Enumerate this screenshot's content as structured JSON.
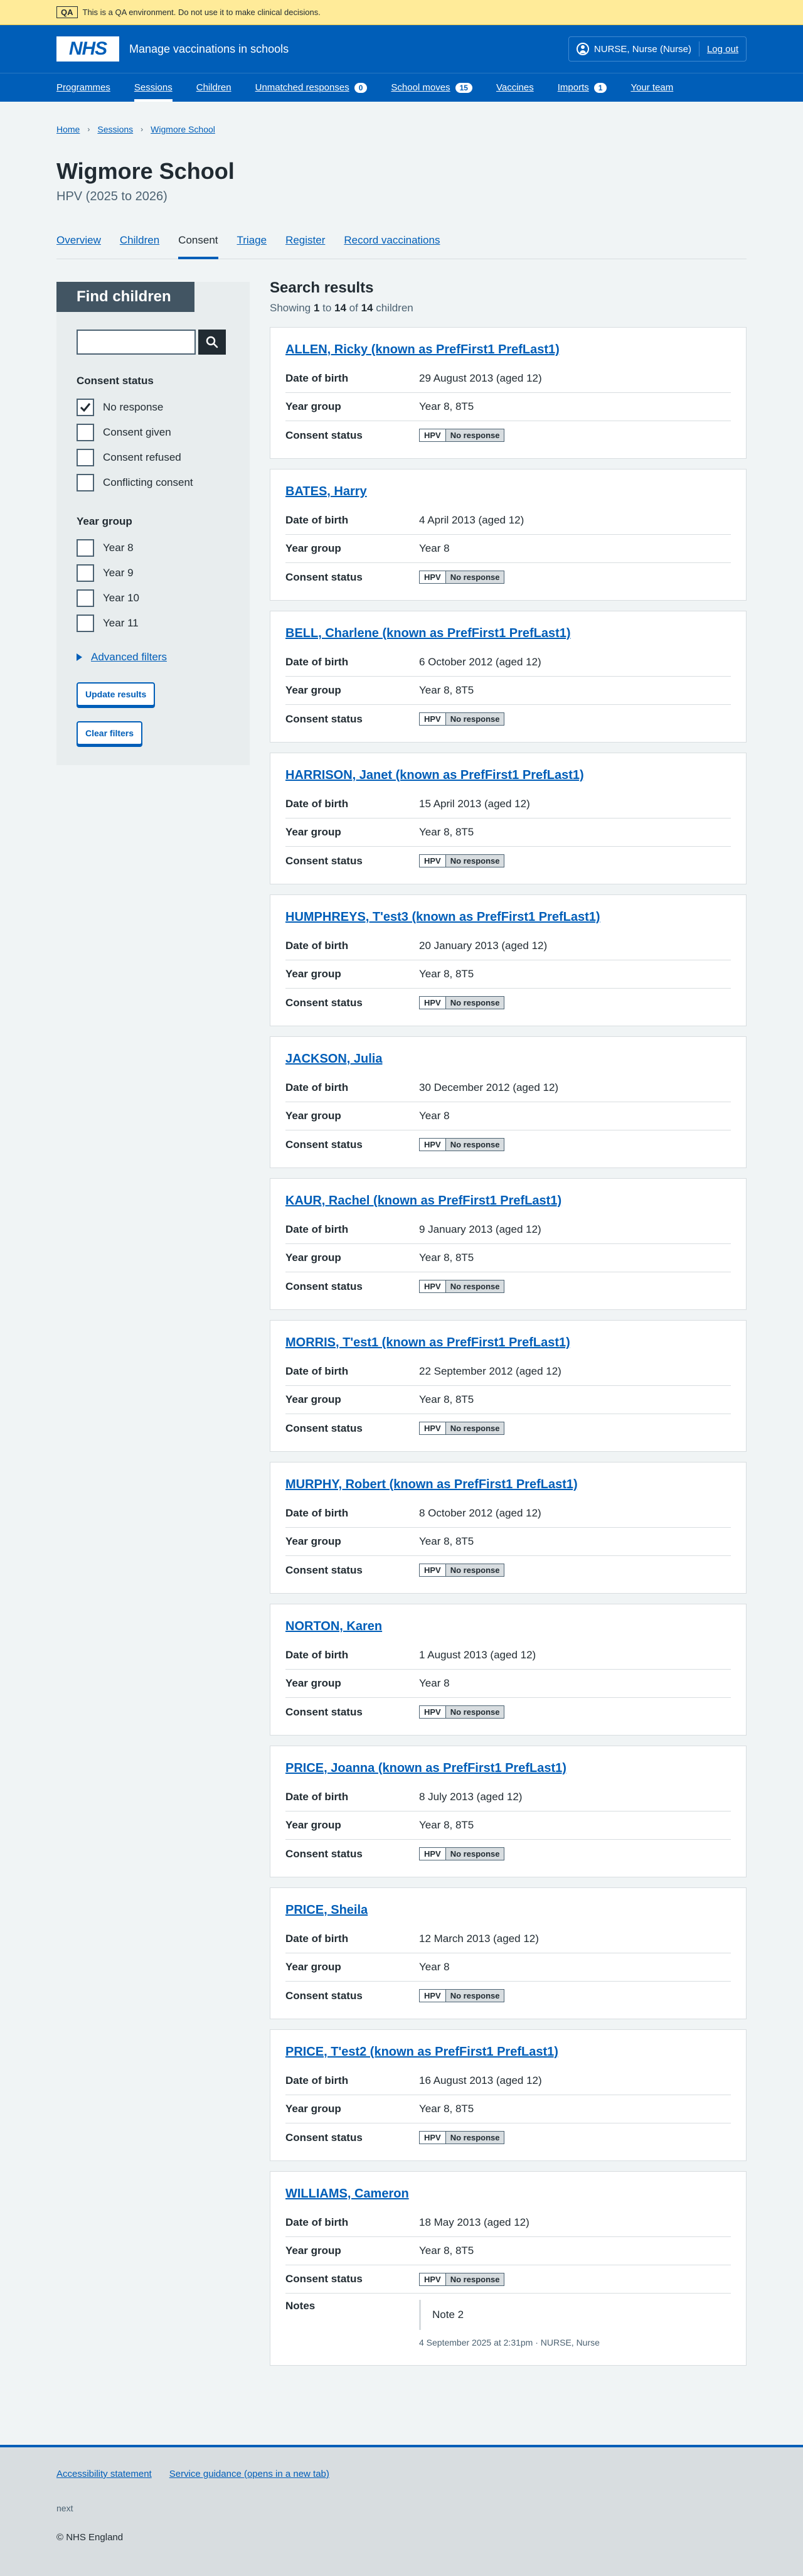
{
  "qa_banner": {
    "tag": "QA",
    "text": "This is a QA environment. Do not use it to make clinical decisions."
  },
  "header": {
    "logo": "NHS",
    "service_name": "Manage vaccinations in schools",
    "account_name": "NURSE, Nurse (Nurse)",
    "logout": "Log out",
    "nav": [
      {
        "label": "Programmes",
        "count": null
      },
      {
        "label": "Sessions",
        "count": null
      },
      {
        "label": "Children",
        "count": null
      },
      {
        "label": "Unmatched responses",
        "count": "0"
      },
      {
        "label": "School moves",
        "count": "15"
      },
      {
        "label": "Vaccines",
        "count": null
      },
      {
        "label": "Imports",
        "count": "1"
      },
      {
        "label": "Your team",
        "count": null
      }
    ]
  },
  "breadcrumbs": [
    "Home",
    "Sessions",
    "Wigmore School"
  ],
  "page": {
    "title": "Wigmore School",
    "subtitle": "HPV (2025 to 2026)",
    "tabs": [
      "Overview",
      "Children",
      "Consent",
      "Triage",
      "Register",
      "Record vaccinations"
    ]
  },
  "filters": {
    "heading": "Find children",
    "search_value": "",
    "consent_legend": "Consent status",
    "consent_options": [
      {
        "label": "No response",
        "checked": true
      },
      {
        "label": "Consent given",
        "checked": false
      },
      {
        "label": "Consent refused",
        "checked": false
      },
      {
        "label": "Conflicting consent",
        "checked": false
      }
    ],
    "year_legend": "Year group",
    "year_options": [
      {
        "label": "Year 8",
        "checked": false
      },
      {
        "label": "Year 9",
        "checked": false
      },
      {
        "label": "Year 10",
        "checked": false
      },
      {
        "label": "Year 11",
        "checked": false
      }
    ],
    "advanced": "Advanced filters",
    "update_button": "Update results",
    "clear_button": "Clear filters"
  },
  "results": {
    "heading": "Search results",
    "count_prefix": "Showing ",
    "from": "1",
    "to_word": " to ",
    "to": "14",
    "of_word": " of ",
    "total": "14",
    "suffix": " children",
    "labels": {
      "dob": "Date of birth",
      "year": "Year group",
      "consent": "Consent status",
      "notes": "Notes"
    },
    "children": [
      {
        "name": "ALLEN, Ricky (known as PrefFirst1 PrefLast1)",
        "dob": "29 August 2013 (aged 12)",
        "year": "Year 8, 8T5",
        "programme": "HPV",
        "status": "No response"
      },
      {
        "name": "BATES, Harry",
        "dob": "4 April 2013 (aged 12)",
        "year": "Year 8",
        "programme": "HPV",
        "status": "No response"
      },
      {
        "name": "BELL, Charlene (known as PrefFirst1 PrefLast1)",
        "dob": "6 October 2012 (aged 12)",
        "year": "Year 8, 8T5",
        "programme": "HPV",
        "status": "No response"
      },
      {
        "name": "HARRISON, Janet (known as PrefFirst1 PrefLast1)",
        "dob": "15 April 2013 (aged 12)",
        "year": "Year 8, 8T5",
        "programme": "HPV",
        "status": "No response"
      },
      {
        "name": "HUMPHREYS, T'est3 (known as PrefFirst1 PrefLast1)",
        "dob": "20 January 2013 (aged 12)",
        "year": "Year 8, 8T5",
        "programme": "HPV",
        "status": "No response"
      },
      {
        "name": "JACKSON, Julia",
        "dob": "30 December 2012 (aged 12)",
        "year": "Year 8",
        "programme": "HPV",
        "status": "No response"
      },
      {
        "name": "KAUR, Rachel (known as PrefFirst1 PrefLast1)",
        "dob": "9 January 2013 (aged 12)",
        "year": "Year 8, 8T5",
        "programme": "HPV",
        "status": "No response"
      },
      {
        "name": "MORRIS, T'est1 (known as PrefFirst1 PrefLast1)",
        "dob": "22 September 2012 (aged 12)",
        "year": "Year 8, 8T5",
        "programme": "HPV",
        "status": "No response"
      },
      {
        "name": "MURPHY, Robert (known as PrefFirst1 PrefLast1)",
        "dob": "8 October 2012 (aged 12)",
        "year": "Year 8, 8T5",
        "programme": "HPV",
        "status": "No response"
      },
      {
        "name": "NORTON, Karen",
        "dob": "1 August 2013 (aged 12)",
        "year": "Year 8",
        "programme": "HPV",
        "status": "No response"
      },
      {
        "name": "PRICE, Joanna (known as PrefFirst1 PrefLast1)",
        "dob": "8 July 2013 (aged 12)",
        "year": "Year 8, 8T5",
        "programme": "HPV",
        "status": "No response"
      },
      {
        "name": "PRICE, Sheila",
        "dob": "12 March 2013 (aged 12)",
        "year": "Year 8",
        "programme": "HPV",
        "status": "No response"
      },
      {
        "name": "PRICE, T'est2 (known as PrefFirst1 PrefLast1)",
        "dob": "16 August 2013 (aged 12)",
        "year": "Year 8, 8T5",
        "programme": "HPV",
        "status": "No response"
      },
      {
        "name": "WILLIAMS, Cameron",
        "dob": "18 May 2013 (aged 12)",
        "year": "Year 8, 8T5",
        "programme": "HPV",
        "status": "No response",
        "note": "Note 2",
        "note_meta": "4 September 2025 at 2:31pm · NURSE, Nurse"
      }
    ]
  },
  "footer": {
    "links": [
      "Accessibility statement",
      "Service guidance (opens in a new tab)"
    ],
    "next": "next",
    "copyright": "© NHS England"
  },
  "colors": {
    "nhs_blue": "#005eb8",
    "qa_yellow": "#ffeb99",
    "dark_grey": "#425563"
  }
}
